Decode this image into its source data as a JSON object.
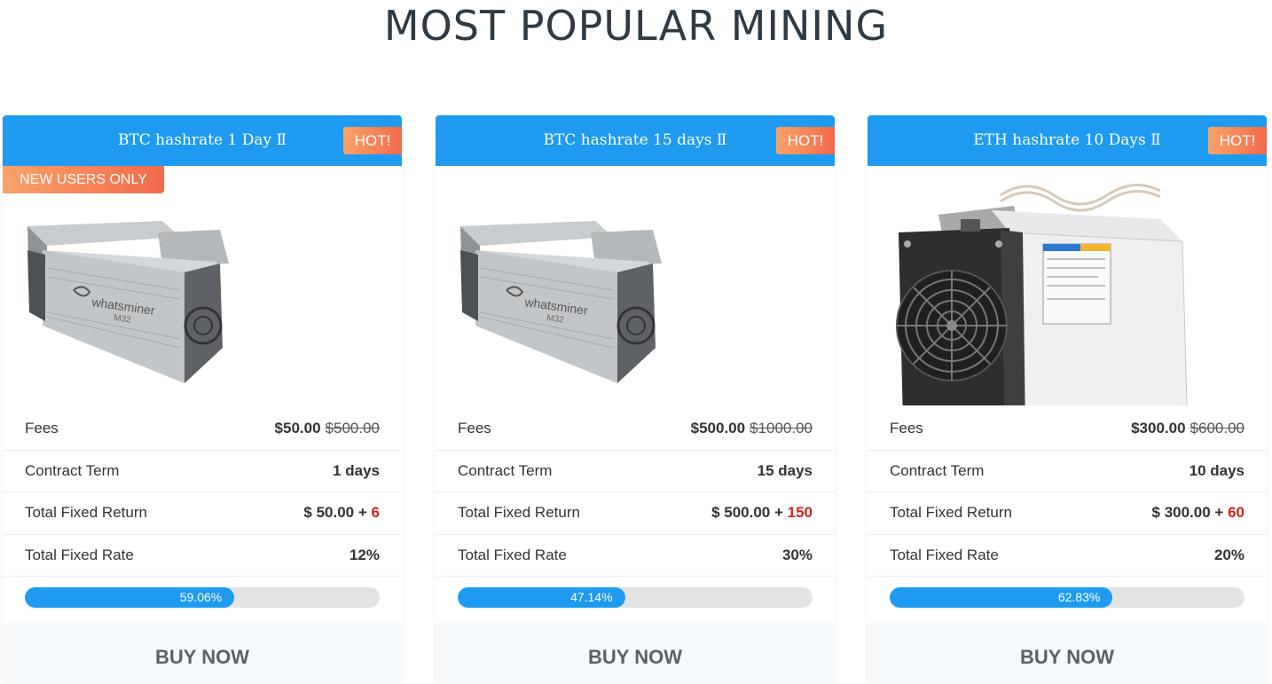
{
  "heading": "MOST POPULAR MINING",
  "accent_color": "#1e9bf0",
  "badge_color": "#f26a4b",
  "cards": [
    {
      "title": "BTC hashrate 1 Day Ⅱ",
      "hot": "HOT!",
      "new_users": "NEW USERS ONLY",
      "image": "whatsminer-m32-icon",
      "fees_label": "Fees",
      "fees_price": "$50.00",
      "fees_old": "$500.00",
      "term_label": "Contract Term",
      "term_value": "1 days",
      "return_label": "Total Fixed Return",
      "return_value": "$ 50.00 +",
      "return_plus": "6",
      "rate_label": "Total Fixed Rate",
      "rate_value": "12%",
      "progress": 59.06,
      "progress_label": "59.06%",
      "buy_label": "BUY NOW"
    },
    {
      "title": "BTC hashrate 15 days Ⅱ",
      "hot": "HOT!",
      "image": "whatsminer-m32-icon",
      "fees_label": "Fees",
      "fees_price": "$500.00",
      "fees_old": "$1000.00",
      "term_label": "Contract Term",
      "term_value": "15 days",
      "return_label": "Total Fixed Return",
      "return_value": "$ 500.00 +",
      "return_plus": "150",
      "rate_label": "Total Fixed Rate",
      "rate_value": "30%",
      "progress": 47.14,
      "progress_label": "47.14%",
      "buy_label": "BUY NOW"
    },
    {
      "title": "ETH hashrate 10 Days Ⅱ",
      "hot": "HOT!",
      "image": "antminer-icon",
      "fees_label": "Fees",
      "fees_price": "$300.00",
      "fees_old": "$600.00",
      "term_label": "Contract Term",
      "term_value": "10 days",
      "return_label": "Total Fixed Return",
      "return_value": "$ 300.00 +",
      "return_plus": "60",
      "rate_label": "Total Fixed Rate",
      "rate_value": "20%",
      "progress": 62.83,
      "progress_label": "62.83%",
      "buy_label": "BUY NOW"
    }
  ]
}
